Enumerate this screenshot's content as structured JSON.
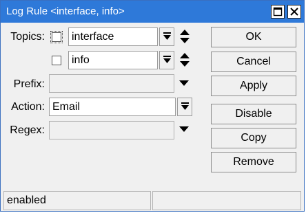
{
  "window": {
    "title": "Log Rule <interface, info>"
  },
  "form": {
    "topics_label": "Topics:",
    "topics": [
      {
        "value": "interface"
      },
      {
        "value": "info"
      }
    ],
    "prefix_label": "Prefix:",
    "prefix_value": "",
    "action_label": "Action:",
    "action_value": "Email",
    "regex_label": "Regex:",
    "regex_value": ""
  },
  "buttons": {
    "ok": "OK",
    "cancel": "Cancel",
    "apply": "Apply",
    "disable": "Disable",
    "copy": "Copy",
    "remove": "Remove"
  },
  "status": {
    "state": "enabled",
    "extra": ""
  },
  "colors": {
    "titlebar": "#2e79d9",
    "window_bg": "#f0f0f0"
  }
}
